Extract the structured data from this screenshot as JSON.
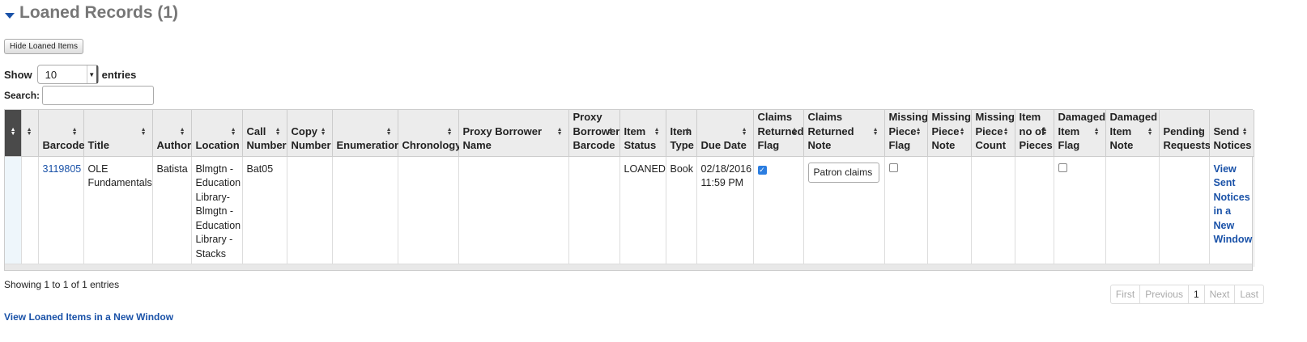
{
  "section": {
    "title": "Loaned Records (1)"
  },
  "hide_button": "Hide Loaned Items",
  "length": {
    "prefix": "Show",
    "value": "10",
    "suffix": "entries"
  },
  "search": {
    "label": "Search:",
    "value": ""
  },
  "table": {
    "headers": {
      "barcode": "Barcode",
      "title": "Title",
      "author": "Author",
      "location": "Location",
      "call_number": "Call Number",
      "copy_number": "Copy Number",
      "enumeration": "Enumeration",
      "chronology": "Chronology",
      "proxy_name": "Proxy Borrower Name",
      "proxy_barcode": "Proxy Borrower Barcode",
      "item_status": "Item Status",
      "item_type": "Item Type",
      "due_date": "Due Date",
      "claims_flag": "Claims Returned Flag",
      "claims_note": "Claims Returned Note",
      "missing_flag": "Missing Piece Flag",
      "missing_note": "Missing Piece Note",
      "missing_count": "Missing Piece Count",
      "item_pieces": "Item no of Pieces",
      "damaged_flag": "Damaged Item Flag",
      "damaged_note": "Damaged Item Note",
      "pending": "Pending Requests",
      "send_notices": "Send Notices"
    },
    "row": {
      "barcode": "3119805",
      "title": "OLE Fundamentals",
      "author": "Batista",
      "location": "Blmgtn - Education Library- Blmgtn - Education Library - Stacks",
      "call_number": "Bat05",
      "item_status": "LOANED",
      "item_type": "Book",
      "due_date": "02/18/2016 11:59 PM",
      "claims_flag_checked": true,
      "claims_note": "Patron claims",
      "missing_flag_checked": false,
      "damaged_flag_checked": false,
      "send_notices_link": "View Sent Notices in a New Window"
    }
  },
  "info_text": "Showing 1 to 1 of 1 entries",
  "pager": {
    "first": "First",
    "previous": "Previous",
    "current": "1",
    "next": "Next",
    "last": "Last"
  },
  "footer_link": "View Loaned Items in a New Window"
}
